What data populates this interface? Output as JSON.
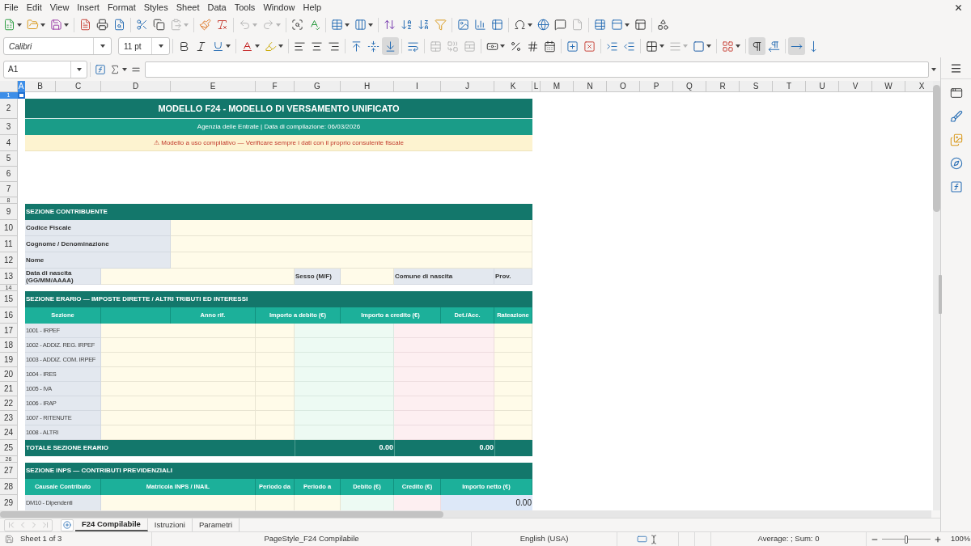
{
  "menu_bar": [
    "File",
    "Edit",
    "View",
    "Insert",
    "Format",
    "Styles",
    "Sheet",
    "Data",
    "Tools",
    "Window",
    "Help"
  ],
  "standard_toolbar": [
    {
      "disabled": false
    },
    {
      "disabled": false
    },
    {
      "disabled": false
    },
    {
      "disabled": false
    },
    {
      "disabled": false
    },
    {
      "disabled": false
    },
    {
      "disabled": false
    },
    {
      "disabled": false
    },
    {
      "disabled": true
    },
    {
      "disabled": false
    },
    {
      "disabled": false
    },
    {
      "disabled": true
    },
    {
      "disabled": true
    },
    {
      "disabled": false
    },
    {
      "disabled": false
    },
    {
      "disabled": false
    },
    {
      "disabled": false
    },
    {
      "disabled": false
    },
    {
      "disabled": false
    },
    {
      "disabled": false
    },
    {
      "disabled": false
    },
    {
      "disabled": false
    },
    {
      "disabled": false
    },
    {
      "disabled": false
    },
    {
      "disabled": false
    },
    {
      "disabled": false
    },
    {
      "disabled": false
    },
    {
      "disabled": true
    },
    {
      "disabled": false
    },
    {
      "disabled": false
    },
    {
      "disabled": false
    },
    {
      "disabled": false
    }
  ],
  "formatting_toolbar": {
    "font_name": "Calibri",
    "font_size": "11 pt",
    "buttons": [
      {
        "disabled": false,
        "pressed": false
      },
      {
        "disabled": false,
        "pressed": false
      },
      {
        "disabled": false,
        "pressed": false
      },
      {
        "disabled": false,
        "pressed": false
      },
      {
        "disabled": false,
        "pressed": false
      },
      {
        "disabled": false,
        "pressed": false
      },
      {
        "disabled": false,
        "pressed": false
      },
      {
        "disabled": false,
        "pressed": false
      },
      {
        "disabled": false,
        "pressed": false
      },
      {
        "disabled": false,
        "pressed": false
      },
      {
        "disabled": false,
        "pressed": true
      },
      {
        "disabled": false,
        "pressed": false
      },
      {
        "disabled": true,
        "pressed": false
      },
      {
        "disabled": true,
        "pressed": false
      },
      {
        "disabled": true,
        "pressed": false
      },
      {
        "disabled": false,
        "pressed": false
      },
      {
        "disabled": false,
        "pressed": false
      },
      {
        "disabled": false,
        "pressed": false
      },
      {
        "disabled": false,
        "pressed": false
      },
      {
        "disabled": false,
        "pressed": false
      },
      {
        "disabled": false,
        "pressed": false
      },
      {
        "disabled": false,
        "pressed": false
      },
      {
        "disabled": false,
        "pressed": false
      },
      {
        "disabled": false,
        "pressed": false
      },
      {
        "disabled": true,
        "pressed": false
      },
      {
        "disabled": false,
        "pressed": false
      },
      {
        "disabled": false,
        "pressed": false
      },
      {
        "disabled": false,
        "pressed": true
      },
      {
        "disabled": false,
        "pressed": false
      },
      {
        "disabled": false,
        "pressed": true
      },
      {
        "disabled": false,
        "pressed": false
      }
    ]
  },
  "formula_bar": {
    "name_box": "A1"
  },
  "sheet": {
    "columns": [
      {
        "label": "A",
        "selected": true
      },
      {
        "label": "B",
        "selected": false
      },
      {
        "label": "C",
        "selected": false
      },
      {
        "label": "D",
        "selected": false
      },
      {
        "label": "E",
        "selected": false
      },
      {
        "label": "F",
        "selected": false
      },
      {
        "label": "G",
        "selected": false
      },
      {
        "label": "H",
        "selected": false
      },
      {
        "label": "I",
        "selected": false
      },
      {
        "label": "J",
        "selected": false
      },
      {
        "label": "K",
        "selected": false
      },
      {
        "label": "L",
        "selected": false
      },
      {
        "label": "M",
        "selected": false
      },
      {
        "label": "N",
        "selected": false
      },
      {
        "label": "O",
        "selected": false
      },
      {
        "label": "P",
        "selected": false
      },
      {
        "label": "Q",
        "selected": false
      },
      {
        "label": "R",
        "selected": false
      },
      {
        "label": "S",
        "selected": false
      },
      {
        "label": "T",
        "selected": false
      },
      {
        "label": "U",
        "selected": false
      },
      {
        "label": "V",
        "selected": false
      },
      {
        "label": "W",
        "selected": false
      },
      {
        "label": "X",
        "selected": false
      }
    ],
    "rows": [
      {
        "number": "1",
        "selected": true,
        "kind": "spacer"
      },
      {
        "number": "2",
        "selected": false,
        "kind": "title",
        "cells": [
          {
            "kind": "title",
            "text": "MODELLO F24 - MODELLO DI VERSAMENTO UNIFICATO"
          }
        ]
      },
      {
        "number": "3",
        "selected": false,
        "kind": "subtitle",
        "cells": [
          {
            "kind": "subtitle",
            "text": "Agenzia delle Entrate | Data di compilazione: 06/03/2026"
          }
        ]
      },
      {
        "number": "4",
        "selected": false,
        "kind": "notice",
        "cells": [
          {
            "kind": "notice",
            "text": "⚠ Modello a uso compilativo — Verificare sempre i dati con il proprio consulente fiscale"
          }
        ]
      },
      {
        "number": "5",
        "selected": false,
        "kind": "blank"
      },
      {
        "number": "6",
        "selected": false,
        "kind": "blank"
      },
      {
        "number": "7",
        "selected": false,
        "kind": "blank"
      },
      {
        "number": "8",
        "selected": false,
        "kind": "spacer"
      },
      {
        "number": "9",
        "selected": false,
        "kind": "section",
        "cells": [
          {
            "kind": "section",
            "text": "SEZIONE CONTRIBUENTE"
          }
        ]
      },
      {
        "number": "10",
        "selected": false,
        "kind": "field",
        "cells": [
          {
            "kind": "label",
            "text": "Codice Fiscale"
          },
          {
            "kind": "input"
          }
        ]
      },
      {
        "number": "11",
        "selected": false,
        "kind": "field",
        "cells": [
          {
            "kind": "label",
            "text": "Cognome / Denominazione"
          },
          {
            "kind": "input"
          }
        ]
      },
      {
        "number": "12",
        "selected": false,
        "kind": "field",
        "cells": [
          {
            "kind": "label",
            "text": "Nome"
          },
          {
            "kind": "input"
          }
        ]
      },
      {
        "number": "13",
        "selected": false,
        "kind": "birth",
        "cells": [
          {
            "kind": "label",
            "text": "Data di nascita (GG/MM/AAAA)"
          },
          {
            "kind": "input"
          },
          {
            "kind": "label",
            "text": "Sesso (M/F)"
          },
          {
            "kind": "input"
          },
          {
            "kind": "label",
            "text": "Comune di nascita"
          },
          {
            "kind": "label",
            "text": "Prov."
          }
        ]
      },
      {
        "number": "14",
        "selected": false,
        "kind": "spacer"
      },
      {
        "number": "15",
        "selected": false,
        "kind": "section",
        "cells": [
          {
            "kind": "section",
            "text": "SEZIONE ERARIO — IMPOSTE DIRETTE / ALTRI TRIBUTI ED INTERESSI"
          }
        ]
      },
      {
        "number": "16",
        "selected": false,
        "kind": "erario_header",
        "cells": [
          {
            "kind": "header",
            "text": "Sezione"
          },
          {
            "kind": "header"
          },
          {
            "kind": "header",
            "text": "Anno rif."
          },
          {
            "kind": "header",
            "text": "Importo a debito (€)"
          },
          {
            "kind": "header",
            "text": "Importo a credito (€)"
          },
          {
            "kind": "header",
            "text": "Det./Acc."
          },
          {
            "kind": "header",
            "text": "Rateazione"
          }
        ]
      },
      {
        "number": "17",
        "selected": false,
        "kind": "erario_line",
        "cells": [
          {
            "kind": "code",
            "text": "1001 - IRPEF"
          },
          {
            "kind": "input"
          },
          {
            "kind": "input"
          },
          {
            "kind": "debit"
          },
          {
            "kind": "credit"
          },
          {
            "kind": "input"
          }
        ]
      },
      {
        "number": "18",
        "selected": false,
        "kind": "erario_line",
        "cells": [
          {
            "kind": "code",
            "text": "1002 - ADDIZ. REG. IRPEF"
          },
          {
            "kind": "input"
          },
          {
            "kind": "input"
          },
          {
            "kind": "debit"
          },
          {
            "kind": "credit"
          },
          {
            "kind": "input"
          }
        ]
      },
      {
        "number": "19",
        "selected": false,
        "kind": "erario_line",
        "cells": [
          {
            "kind": "code",
            "text": "1003 - ADDIZ. COM. IRPEF"
          },
          {
            "kind": "input"
          },
          {
            "kind": "input"
          },
          {
            "kind": "debit"
          },
          {
            "kind": "credit"
          },
          {
            "kind": "input"
          }
        ]
      },
      {
        "number": "20",
        "selected": false,
        "kind": "erario_line",
        "cells": [
          {
            "kind": "code",
            "text": "1004 - IRES"
          },
          {
            "kind": "input"
          },
          {
            "kind": "input"
          },
          {
            "kind": "debit"
          },
          {
            "kind": "credit"
          },
          {
            "kind": "input"
          }
        ]
      },
      {
        "number": "21",
        "selected": false,
        "kind": "erario_line",
        "cells": [
          {
            "kind": "code",
            "text": "1005 - IVA"
          },
          {
            "kind": "input"
          },
          {
            "kind": "input"
          },
          {
            "kind": "debit"
          },
          {
            "kind": "credit"
          },
          {
            "kind": "input"
          }
        ]
      },
      {
        "number": "22",
        "selected": false,
        "kind": "erario_line",
        "cells": [
          {
            "kind": "code",
            "text": "1006 - IRAP"
          },
          {
            "kind": "input"
          },
          {
            "kind": "input"
          },
          {
            "kind": "debit"
          },
          {
            "kind": "credit"
          },
          {
            "kind": "input"
          }
        ]
      },
      {
        "number": "23",
        "selected": false,
        "kind": "erario_line",
        "cells": [
          {
            "kind": "code",
            "text": "1007 - RITENUTE"
          },
          {
            "kind": "input"
          },
          {
            "kind": "input"
          },
          {
            "kind": "debit"
          },
          {
            "kind": "credit"
          },
          {
            "kind": "input"
          }
        ]
      },
      {
        "number": "24",
        "selected": false,
        "kind": "erario_line",
        "cells": [
          {
            "kind": "code",
            "text": "1008 - ALTRI"
          },
          {
            "kind": "input"
          },
          {
            "kind": "input"
          },
          {
            "kind": "debit"
          },
          {
            "kind": "credit"
          },
          {
            "kind": "input"
          }
        ]
      },
      {
        "number": "25",
        "selected": false,
        "kind": "total",
        "cells": [
          {
            "kind": "total_label",
            "text": "TOTALE SEZIONE ERARIO"
          },
          {
            "kind": "total_amount",
            "text": "0.00"
          },
          {
            "kind": "total_amount",
            "text": "0.00"
          },
          {
            "kind": "total_blank"
          }
        ]
      },
      {
        "number": "26",
        "selected": false,
        "kind": "spacer"
      },
      {
        "number": "27",
        "selected": false,
        "kind": "section",
        "cells": [
          {
            "kind": "section",
            "text": "SEZIONE INPS — CONTRIBUTI PREVIDENZIALI"
          }
        ]
      },
      {
        "number": "28",
        "selected": false,
        "kind": "inps_header",
        "cells": [
          {
            "kind": "header",
            "text": "Causale Contributo"
          },
          {
            "kind": "header",
            "text": "Matricola INPS / INAIL"
          },
          {
            "kind": "header",
            "text": "Periodo da"
          },
          {
            "kind": "header",
            "text": "Periodo a"
          },
          {
            "kind": "header",
            "text": "Debito (€)"
          },
          {
            "kind": "header",
            "text": "Credito (€)"
          },
          {
            "kind": "header",
            "text": "Importo netto (€)"
          }
        ]
      },
      {
        "number": "29",
        "selected": false,
        "kind": "inps_line",
        "cells": [
          {
            "kind": "code",
            "text": "DM10 - Dipendenti"
          },
          {
            "kind": "input"
          },
          {
            "kind": "input"
          },
          {
            "kind": "input"
          },
          {
            "kind": "debit"
          },
          {
            "kind": "credit"
          },
          {
            "kind": "net",
            "text": "0.00"
          }
        ]
      }
    ]
  },
  "sheet_navigation": [
    {
      "disabled": true
    },
    {
      "disabled": true
    },
    {
      "disabled": true
    },
    {
      "disabled": true
    }
  ],
  "sheet_tabs": [
    {
      "label": "F24 Compilabile",
      "selected": true
    },
    {
      "label": "Istruzioni",
      "selected": false
    },
    {
      "label": "Parametri",
      "selected": false
    }
  ],
  "status_bar": {
    "sheet_count": "Sheet 1 of 3",
    "page_style": "PageStyle_F24 Compilabile",
    "language": "English (USA)",
    "selection_summary": "Average: ; Sum: 0",
    "zoom_slider": {
      "level": 0.5
    },
    "zoom": "100%"
  }
}
